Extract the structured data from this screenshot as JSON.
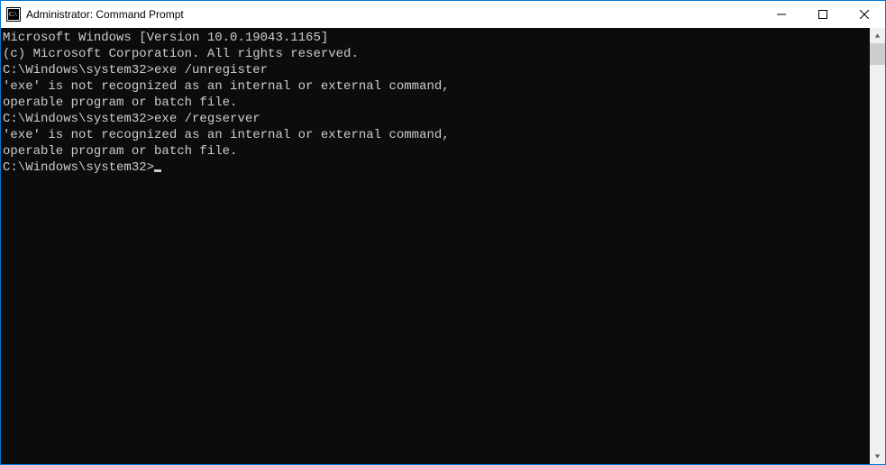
{
  "titlebar": {
    "title": "Administrator: Command Prompt"
  },
  "console": {
    "lines": [
      "Microsoft Windows [Version 10.0.19043.1165]",
      "(c) Microsoft Corporation. All rights reserved.",
      "",
      "C:\\Windows\\system32>exe /unregister",
      "'exe' is not recognized as an internal or external command,",
      "operable program or batch file.",
      "",
      "C:\\Windows\\system32>exe /regserver",
      "'exe' is not recognized as an internal or external command,",
      "operable program or batch file.",
      ""
    ],
    "prompt": "C:\\Windows\\system32>"
  }
}
